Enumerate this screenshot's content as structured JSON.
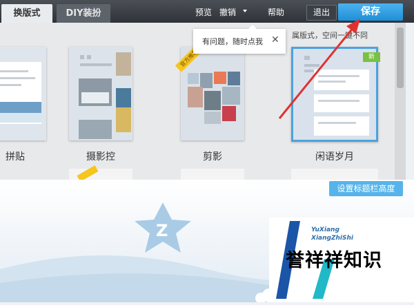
{
  "toolbar": {
    "tabs": [
      {
        "label": "换版式",
        "active": true
      },
      {
        "label": "DIY装扮",
        "active": false
      }
    ],
    "preview": "预览",
    "undo": "撤销",
    "help": "帮助",
    "exit": "退出",
    "save": "保存",
    "accent": "#2a9be2"
  },
  "templates": [
    {
      "label": "拼贴",
      "selected": false
    },
    {
      "label": "摄影控",
      "selected": false
    },
    {
      "label": "剪影",
      "selected": false,
      "badge": "官方推荐"
    },
    {
      "label": "闲语岁月",
      "selected": true,
      "badge": "新"
    }
  ],
  "tooltip": {
    "text": "有问题，随时点我",
    "close": "✕"
  },
  "hint": "属版式，空间一键不同",
  "actions": {
    "set_title_height": "设置标题栏高度"
  },
  "watermark": {
    "line1": "YuXiang",
    "line2": "XiangZhiShi",
    "chinese": "誉祥祥知识"
  }
}
